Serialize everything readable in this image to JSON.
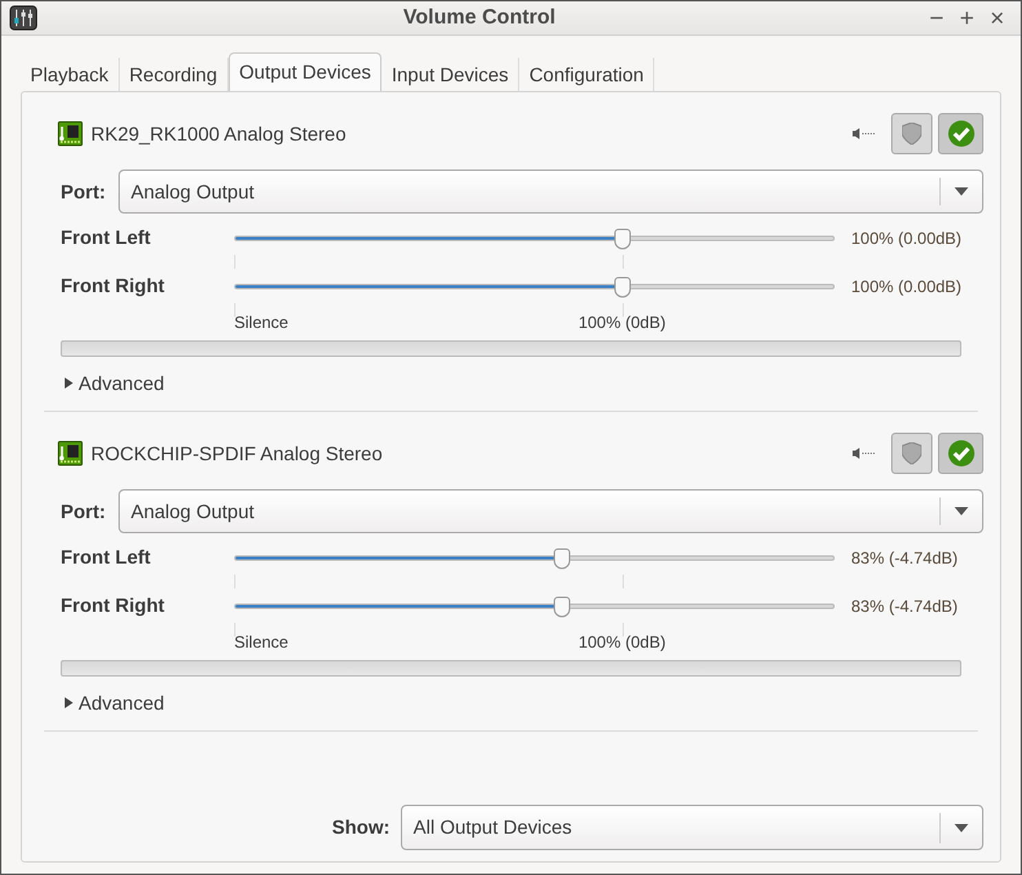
{
  "window": {
    "title": "Volume Control",
    "controls": [
      "−",
      "+",
      "×"
    ]
  },
  "tabs": [
    {
      "label": "Playback",
      "selected": false
    },
    {
      "label": "Recording",
      "selected": false
    },
    {
      "label": "Output Devices",
      "selected": true
    },
    {
      "label": "Input Devices",
      "selected": false
    },
    {
      "label": "Configuration",
      "selected": false
    }
  ],
  "devices": [
    {
      "name": "RK29_RK1000 Analog Stereo",
      "muted": false,
      "default": true,
      "port_label": "Port:",
      "port": "Analog Output",
      "channels": [
        {
          "name": "Front Left",
          "level": 0.646,
          "reading": "100% (0.00dB)"
        },
        {
          "name": "Front Right",
          "level": 0.646,
          "reading": "100% (0.00dB)"
        }
      ],
      "scale": [
        "Silence",
        "100% (0dB)"
      ],
      "advanced": "Advanced",
      "expanded": false
    },
    {
      "name": "ROCKCHIP-SPDIF Analog Stereo",
      "muted": false,
      "default": true,
      "port_label": "Port:",
      "port": "Analog Output",
      "channels": [
        {
          "name": "Front Left",
          "level": 0.545,
          "reading": "83% (-4.74dB)"
        },
        {
          "name": "Front Right",
          "level": 0.545,
          "reading": "83% (-4.74dB)"
        }
      ],
      "scale": [
        "Silence",
        "100% (0dB)"
      ],
      "advanced": "Advanced",
      "expanded": false
    }
  ],
  "show": {
    "label": "Show:",
    "value": "All Output Devices"
  }
}
